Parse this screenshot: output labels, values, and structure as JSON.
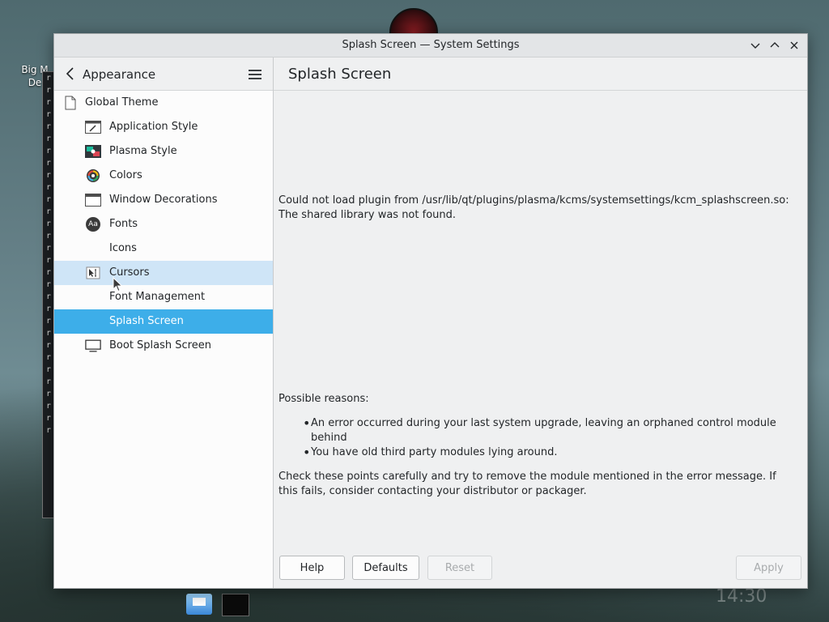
{
  "desktop": {
    "icon_label": "Big M\nDe",
    "clock": "14:30"
  },
  "window": {
    "title": "Splash Screen — System Settings"
  },
  "sidebar": {
    "title": "Appearance",
    "items": [
      {
        "label": "Global Theme",
        "icon": "page-icon"
      },
      {
        "label": "Application Style",
        "icon": "application-style-icon"
      },
      {
        "label": "Plasma Style",
        "icon": "plasma-style-icon"
      },
      {
        "label": "Colors",
        "icon": "colors-icon"
      },
      {
        "label": "Window Decorations",
        "icon": "window-decorations-icon"
      },
      {
        "label": "Fonts",
        "icon": "fonts-icon"
      },
      {
        "label": "Icons",
        "icon": ""
      },
      {
        "label": "Cursors",
        "icon": "cursors-icon"
      },
      {
        "label": "Font Management",
        "icon": ""
      },
      {
        "label": "Splash Screen",
        "icon": ""
      },
      {
        "label": "Boot Splash Screen",
        "icon": "monitor-icon"
      }
    ],
    "fonts_icon_text": "Aa"
  },
  "main": {
    "title": "Splash Screen",
    "error": "Could not load plugin from /usr/lib/qt/plugins/plasma/kcms/systemsettings/kcm_splashscreen.so: The shared library was not found.",
    "reasons_heading": "Possible reasons:",
    "reasons": [
      "An error occurred during your last system upgrade, leaving an orphaned control module behind",
      "You have old third party modules lying around."
    ],
    "advice": "Check these points carefully and try to remove the module mentioned in the error message. If this fails, consider contacting your distributor or packager."
  },
  "buttons": {
    "help": "Help",
    "defaults": "Defaults",
    "reset": "Reset",
    "apply": "Apply"
  },
  "colors": {
    "selection": "#3daee9",
    "hover": "#cfe5f7"
  }
}
